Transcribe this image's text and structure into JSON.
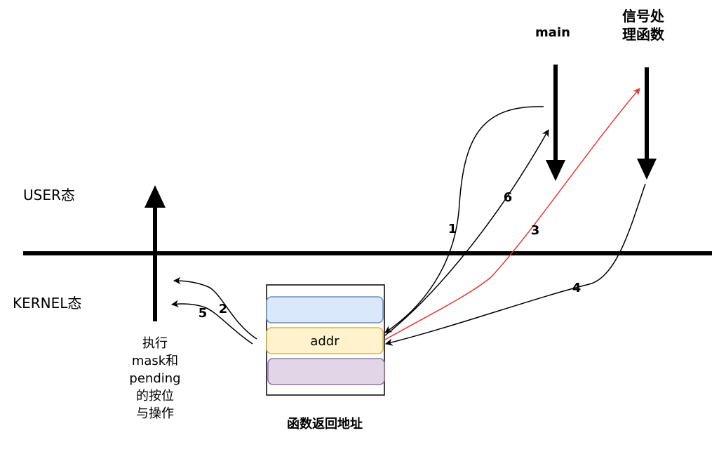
{
  "labels": {
    "main": "main",
    "signal_handler_line1": "信号处",
    "signal_handler_line2": "理函数",
    "user_mode": "USER态",
    "kernel_mode": "KERNEL态",
    "stack_caption": "函数返回地址",
    "addr_slot": "addr",
    "kernel_action": [
      "执行",
      "mask和",
      "pending",
      "的按位",
      "与操作"
    ]
  },
  "steps": {
    "s1": "1",
    "s2": "2",
    "s3": "3",
    "s4": "4",
    "s5": "5",
    "s6": "6"
  },
  "colors": {
    "divider": "#000000",
    "arrow_default": "#000000",
    "arrow_highlight": "#e53935",
    "slot_top_fill": "#dae8fc",
    "slot_top_stroke": "#6c8ebf",
    "slot_addr_fill": "#fff2cc",
    "slot_addr_stroke": "#d6b656",
    "slot_bottom_fill": "#e1d5e7",
    "slot_bottom_stroke": "#9673a6"
  }
}
